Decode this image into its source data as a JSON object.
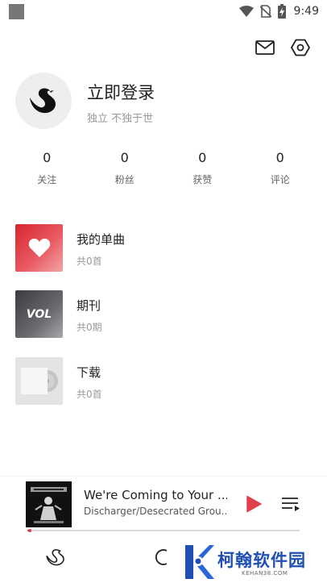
{
  "status_bar": {
    "time": "9:49",
    "icons": [
      "app-notification-icon",
      "wifi-icon",
      "no-sim-icon",
      "battery-charging-icon"
    ]
  },
  "header": {
    "icons": [
      "mail-icon",
      "settings-hexagon-icon"
    ]
  },
  "profile": {
    "avatar_icon": "swan-logo-icon",
    "title": "立即登录",
    "subtitle": "独立 不独于世"
  },
  "stats": [
    {
      "value": "0",
      "label": "关注"
    },
    {
      "value": "0",
      "label": "粉丝"
    },
    {
      "value": "0",
      "label": "获赞"
    },
    {
      "value": "0",
      "label": "评论"
    }
  ],
  "library": [
    {
      "title": "我的单曲",
      "sub": "共0首",
      "icon": "heart-icon"
    },
    {
      "title": "期刊",
      "sub": "共0期",
      "icon_text": "VOL"
    },
    {
      "title": "下载",
      "sub": "共0首",
      "icon": "vinyl-record-icon"
    }
  ],
  "player": {
    "title": "We're Coming to Your ...",
    "artist": "Discharger/Desecrated Grou...",
    "progress": 0.01,
    "accent": "#e0404a"
  },
  "bottom_nav": {
    "icons": [
      "swan-home-icon",
      "discover-circle-icon"
    ]
  },
  "watermark": {
    "brand": "柯翰软件园",
    "url": "KEHAN38.COM"
  },
  "colors": {
    "accent_red": "#d7262f",
    "watermark_blue": "#1f4fb3"
  }
}
